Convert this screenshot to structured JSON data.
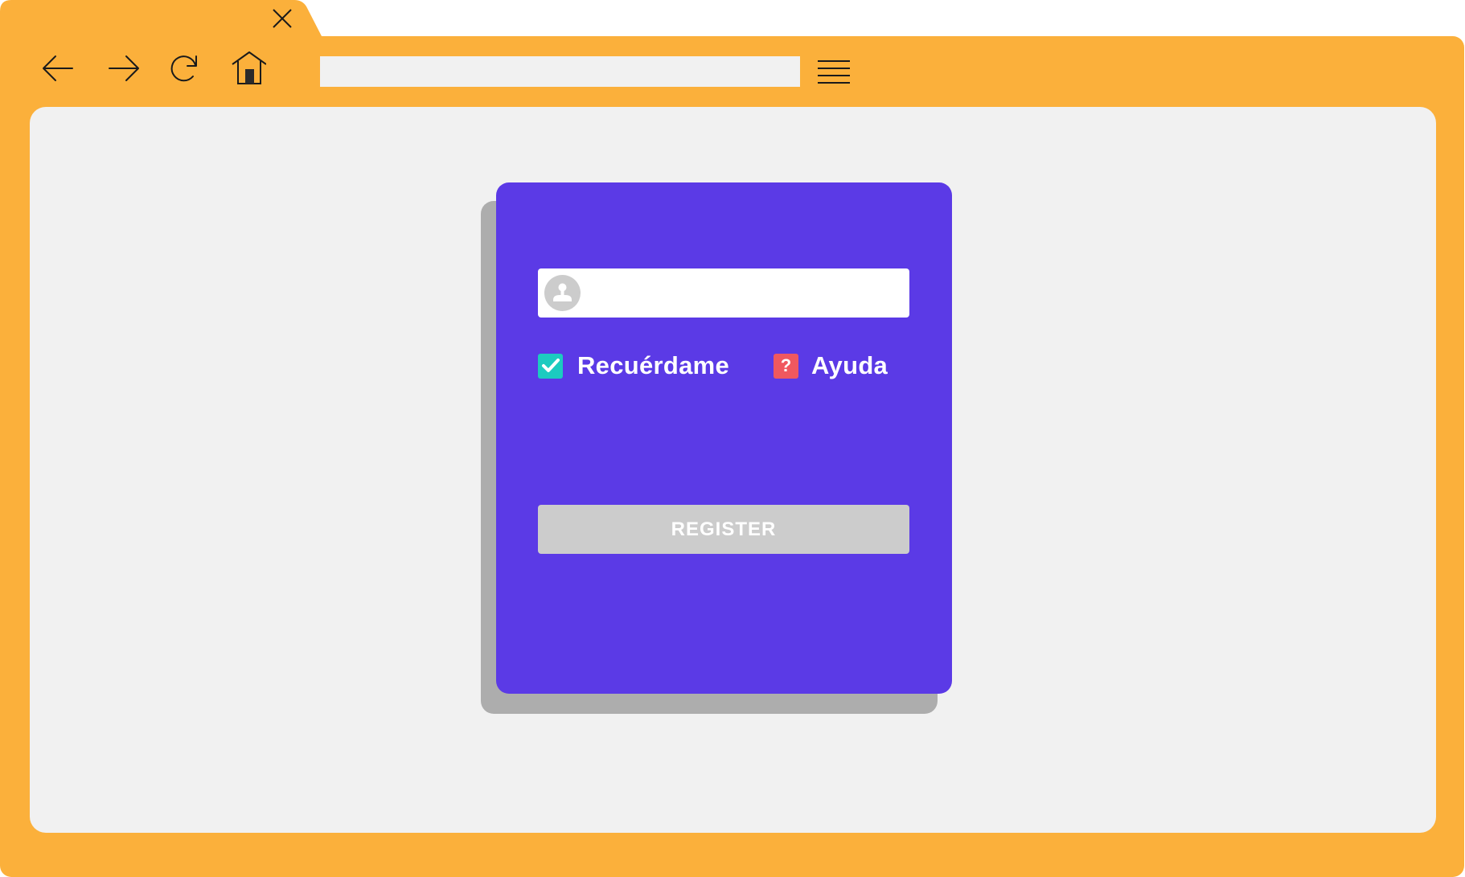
{
  "colors": {
    "frame": "#fbb03b",
    "accent": "#5b3ae6",
    "checkbox_checked": "#1ccbc0",
    "help_badge": "#f0585f",
    "button_disabled": "#cccccc"
  },
  "browser": {
    "tab_icon": "close-icon",
    "toolbar_icons": [
      "back-arrow-icon",
      "forward-arrow-icon",
      "reload-icon",
      "home-icon",
      "hamburger-menu-icon"
    ],
    "address_value": ""
  },
  "form": {
    "username": {
      "icon": "user-avatar-icon",
      "value": ""
    },
    "remember": {
      "label": "Recuérdame",
      "checked": true
    },
    "help": {
      "label": "Ayuda",
      "badge": "?"
    },
    "register_label": "REGISTER"
  }
}
